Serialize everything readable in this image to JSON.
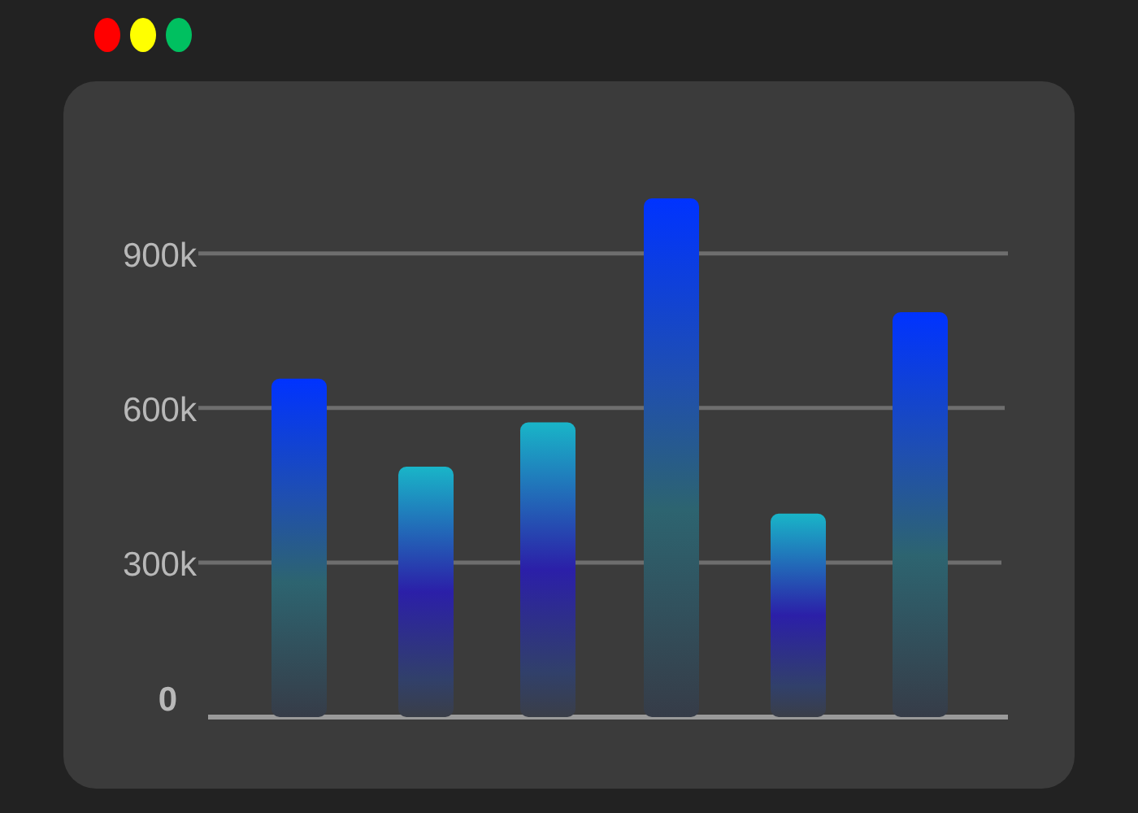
{
  "window_controls": [
    {
      "color": "#ff0000"
    },
    {
      "color": "#ffff00"
    },
    {
      "color": "#00c060"
    }
  ],
  "chart": {
    "chart_data": {
      "type": "bar",
      "grid": true,
      "series": [
        {
          "color": "#0033ff",
          "values": [
            657000,
            null,
            null,
            1007000,
            null,
            786000
          ]
        },
        {
          "color": "#19b5c8",
          "values": [
            null,
            486000,
            572000,
            null,
            395000,
            null
          ]
        }
      ],
      "ylim": [
        0,
        1007000
      ],
      "yticks": [
        {
          "value": 0,
          "label": "0"
        },
        {
          "value": 300000,
          "label": "300k"
        },
        {
          "value": 600000,
          "label": "600k"
        },
        {
          "value": 900000,
          "label": "900k"
        }
      ]
    }
  }
}
